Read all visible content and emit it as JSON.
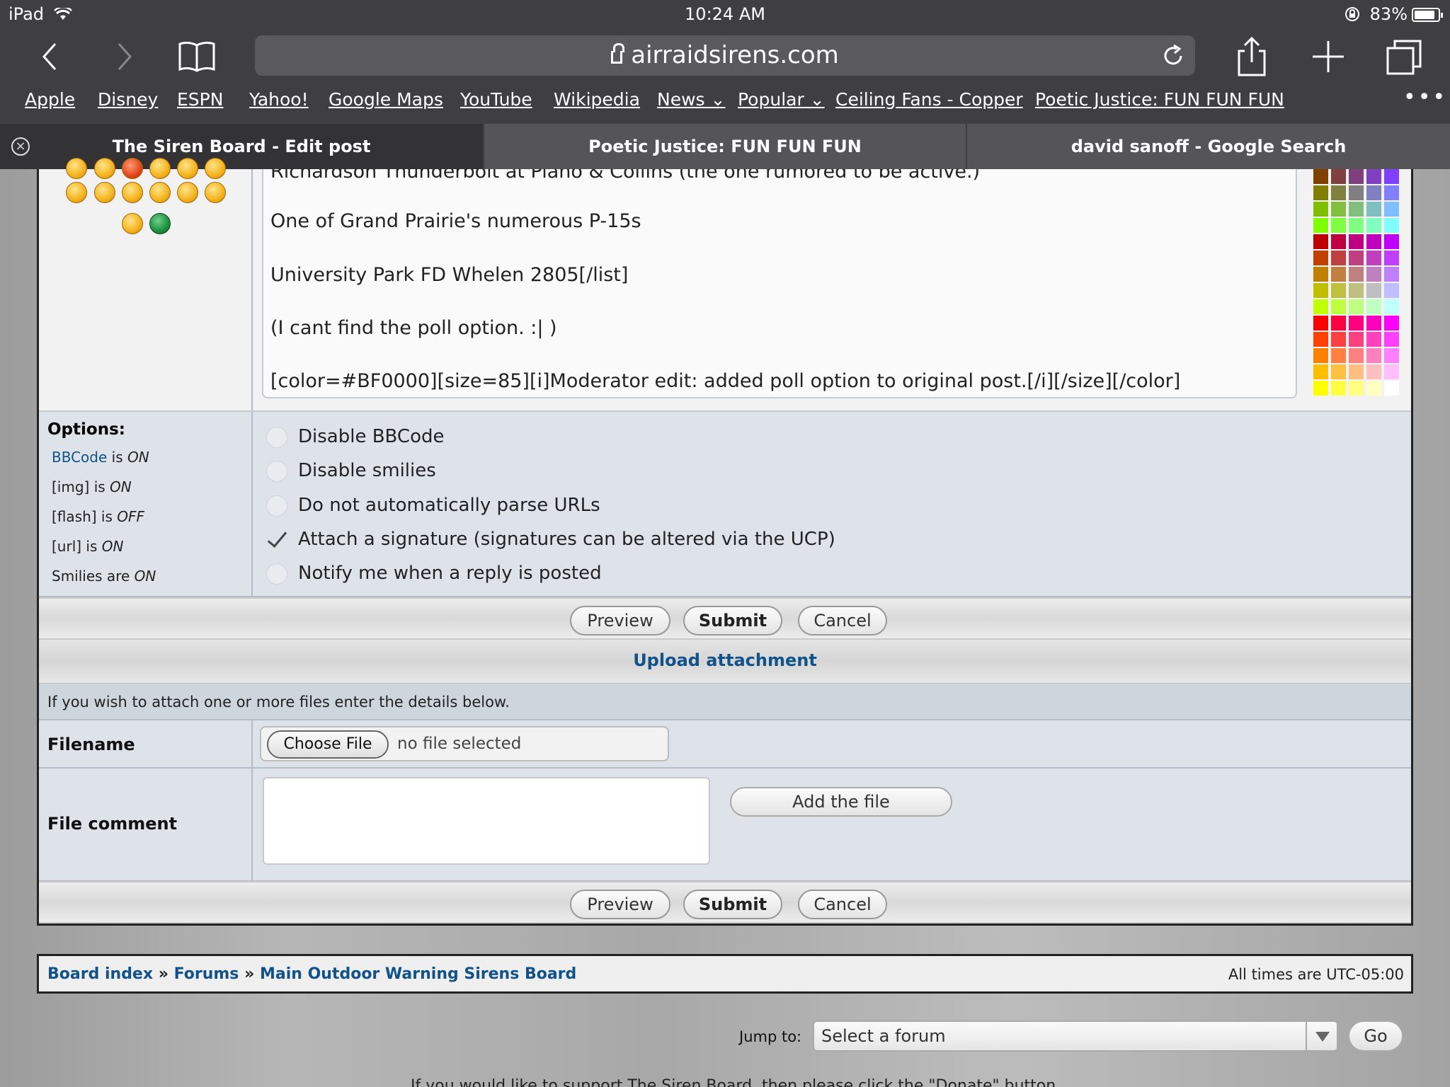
{
  "status": {
    "device": "iPad",
    "time": "10:24 AM",
    "battery": "83%"
  },
  "browser": {
    "url": "airraidsirens.com",
    "bookmarks": [
      "Apple",
      "Disney",
      "ESPN",
      "Yahoo!",
      "Google Maps",
      "YouTube",
      "Wikipedia",
      "News ⌄",
      "Popular ⌄",
      "Ceiling Fans - Copper",
      "Poetic Justice: FUN FUN FUN"
    ],
    "more": "•••",
    "tabs": [
      "The Siren Board - Edit post",
      "Poetic Justice: FUN FUN FUN",
      "david sanoff - Google Search"
    ],
    "tab_close": "×"
  },
  "post": {
    "lines": [
      "Richardson Thunderbolt at Piano & Collins (the one rumored to be active.)",
      "One of Grand Prairie's numerous P-15s",
      "University Park FD Whelen 2805[/list]",
      "(I cant find the poll option.  :| )",
      "[color=#BF0000][size=85][i]Moderator edit: added poll option to original post.[/i][/size][/color]"
    ]
  },
  "palette_colors": [
    [
      "#804000",
      "#804040",
      "#804080",
      "#8040bf",
      "#8040ff"
    ],
    [
      "#808000",
      "#808040",
      "#808080",
      "#8080bf",
      "#8080ff"
    ],
    [
      "#80bf00",
      "#80bf40",
      "#80bf80",
      "#80bfbf",
      "#80bfff"
    ],
    [
      "#80ff00",
      "#80ff40",
      "#80ff80",
      "#80ffbf",
      "#80ffff"
    ],
    [
      "#bf0000",
      "#bf0040",
      "#bf0080",
      "#bf00bf",
      "#bf00ff"
    ],
    [
      "#bf4000",
      "#bf4040",
      "#bf4080",
      "#bf40bf",
      "#bf40ff"
    ],
    [
      "#bf8000",
      "#bf8040",
      "#bf8080",
      "#bf80bf",
      "#bf80ff"
    ],
    [
      "#bfbf00",
      "#bfbf40",
      "#bfbf80",
      "#bfbfbf",
      "#bfbfff"
    ],
    [
      "#bfff00",
      "#bfff40",
      "#bfff80",
      "#bfffbf",
      "#bfffff"
    ],
    [
      "#ff0000",
      "#ff0040",
      "#ff0080",
      "#ff00bf",
      "#ff00ff"
    ],
    [
      "#ff4000",
      "#ff4040",
      "#ff4080",
      "#ff40bf",
      "#ff40ff"
    ],
    [
      "#ff8000",
      "#ff8040",
      "#ff8080",
      "#ff80bf",
      "#ff80ff"
    ],
    [
      "#ffbf00",
      "#ffbf40",
      "#ffbf80",
      "#ffbfbf",
      "#ffbfff"
    ],
    [
      "#ffff00",
      "#ffff40",
      "#ffff80",
      "#ffffbf",
      "#ffffff"
    ]
  ],
  "options": {
    "title": "Options:",
    "info": [
      {
        "pre": "",
        "link": "BBCode",
        "mid": " is ",
        "state": "ON"
      },
      {
        "pre": "[img]",
        "link": "",
        "mid": " is ",
        "state": "ON"
      },
      {
        "pre": "[flash]",
        "link": "",
        "mid": " is ",
        "state": "OFF"
      },
      {
        "pre": "[url]",
        "link": "",
        "mid": " is ",
        "state": "ON"
      },
      {
        "pre": "Smilies",
        "link": "",
        "mid": " are ",
        "state": "ON"
      }
    ],
    "checkboxes": [
      {
        "label": "Disable BBCode",
        "checked": false
      },
      {
        "label": "Disable smilies",
        "checked": false
      },
      {
        "label": "Do not automatically parse URLs",
        "checked": false
      },
      {
        "label": "Attach a signature (signatures can be altered via the UCP)",
        "checked": true
      },
      {
        "label": "Notify me when a reply is posted",
        "checked": false
      }
    ]
  },
  "buttons": {
    "preview": "Preview",
    "submit": "Submit",
    "cancel": "Cancel"
  },
  "upload": {
    "heading": "Upload attachment",
    "info": "If you wish to attach one or more files enter the details below.",
    "filename_label": "Filename",
    "choose_file": "Choose File",
    "no_file": "no file selected",
    "comment_label": "File comment",
    "add_file": "Add the file"
  },
  "footer": {
    "board_index": "Board index",
    "sep": "»",
    "forums": "Forums",
    "board": "Main Outdoor Warning Sirens Board",
    "timezone": "All times are UTC-05:00",
    "jump_label": "Jump to:",
    "jump_value": "Select a forum",
    "go": "Go",
    "cut_text": "If you would like to support The Siren Board, then please click the \"Donate\" button"
  }
}
